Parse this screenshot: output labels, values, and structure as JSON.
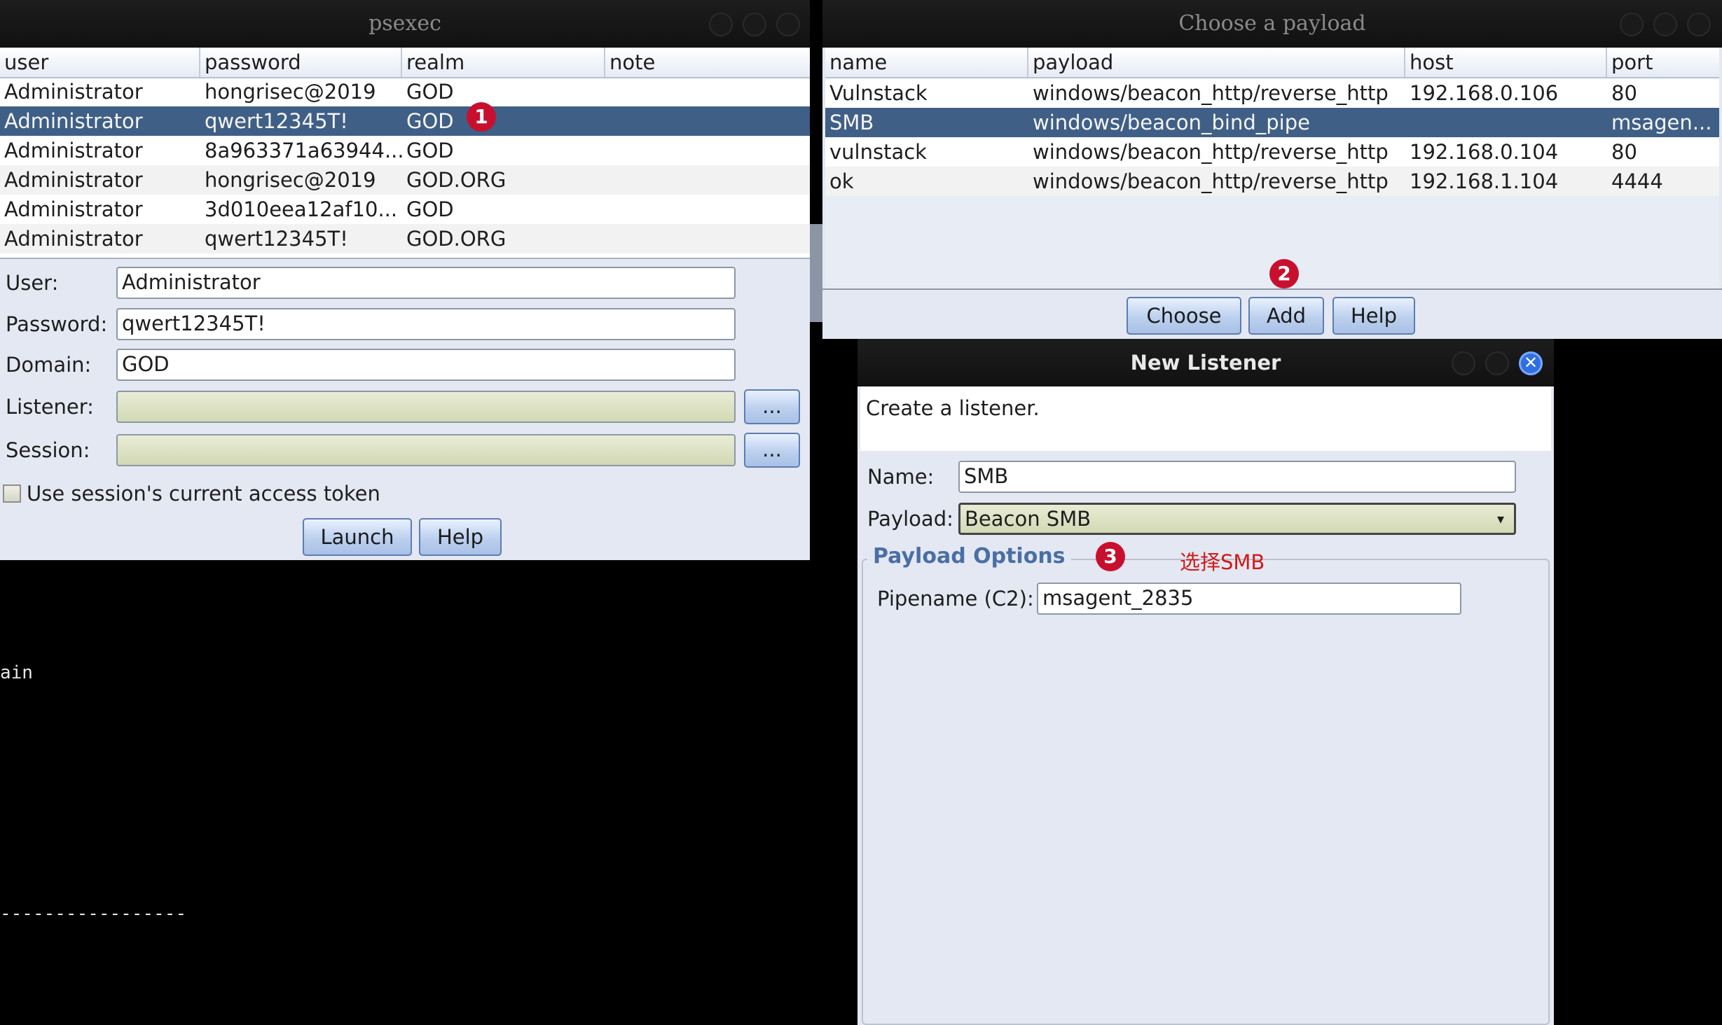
{
  "terminal": {
    "line1": "ain",
    "line2": "-----------------"
  },
  "psexec": {
    "title": "psexec",
    "columns": [
      "user",
      "password",
      "realm",
      "note"
    ],
    "rows": [
      {
        "user": "Administrator",
        "password": "hongrisec@2019",
        "realm": "GOD",
        "note": ""
      },
      {
        "user": "Administrator",
        "password": "qwert12345T!",
        "realm": "GOD",
        "note": ""
      },
      {
        "user": "Administrator",
        "password": "8a963371a63944...",
        "realm": "GOD",
        "note": ""
      },
      {
        "user": "Administrator",
        "password": "hongrisec@2019",
        "realm": "GOD.ORG",
        "note": ""
      },
      {
        "user": "Administrator",
        "password": "3d010eea12af10...",
        "realm": "GOD",
        "note": ""
      },
      {
        "user": "Administrator",
        "password": "qwert12345T!",
        "realm": "GOD.ORG",
        "note": ""
      }
    ],
    "form": {
      "user_label": "User:",
      "user_value": "Administrator",
      "password_label": "Password:",
      "password_value": "qwert12345T!",
      "domain_label": "Domain:",
      "domain_value": "GOD",
      "listener_label": "Listener:",
      "listener_value": "",
      "session_label": "Session:",
      "session_value": "",
      "browse_label": "...",
      "token_label": "Use session's current access token"
    },
    "buttons": {
      "launch": "Launch",
      "help": "Help"
    }
  },
  "payload_chooser": {
    "title": "Choose a payload",
    "columns": [
      "name",
      "payload",
      "host",
      "port"
    ],
    "rows": [
      {
        "name": "Vulnstack",
        "payload": "windows/beacon_http/reverse_http",
        "host": "192.168.0.106",
        "port": "80"
      },
      {
        "name": "SMB",
        "payload": "windows/beacon_bind_pipe",
        "host": "",
        "port": "msagen..."
      },
      {
        "name": "vulnstack",
        "payload": "windows/beacon_http/reverse_http",
        "host": "192.168.0.104",
        "port": "80"
      },
      {
        "name": "ok",
        "payload": "windows/beacon_http/reverse_http",
        "host": "192.168.1.104",
        "port": "4444"
      }
    ],
    "buttons": {
      "choose": "Choose",
      "add": "Add",
      "help": "Help"
    }
  },
  "new_listener": {
    "title": "New Listener",
    "description": "Create a listener.",
    "name_label": "Name:",
    "name_value": "SMB",
    "payload_label": "Payload:",
    "payload_value": "Beacon SMB",
    "options_title": "Payload Options",
    "pipename_label": "Pipename (C2):",
    "pipename_value": "msagent_2835",
    "close_glyph": "✕"
  },
  "annotations": {
    "step1": "1",
    "step2": "2",
    "step3": "3",
    "note3": "选择SMB",
    "color": "#c8102e"
  }
}
